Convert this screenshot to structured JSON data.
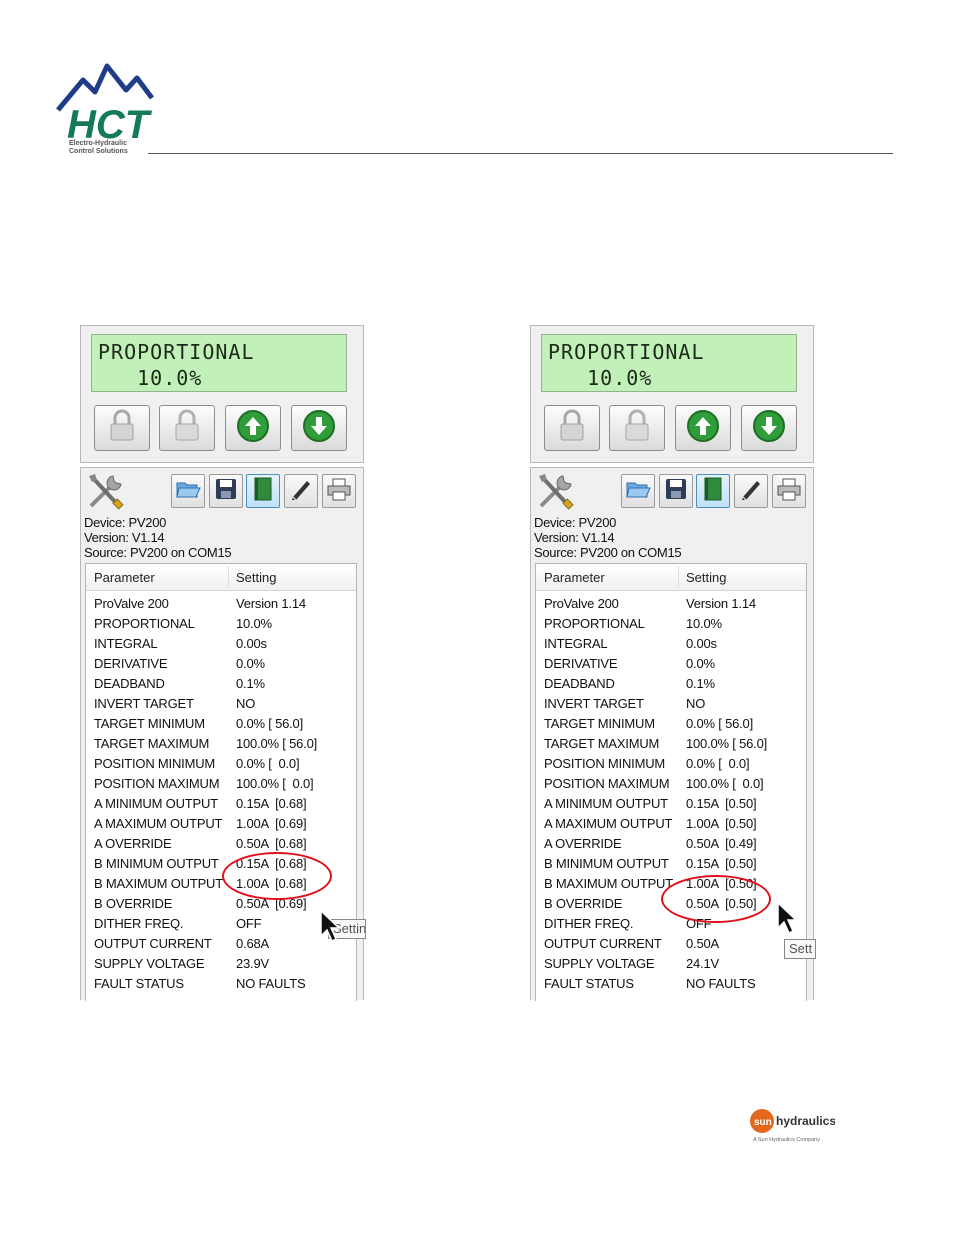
{
  "brand": {
    "name": "HCT",
    "tagline_line1": "Electro-Hydraulic",
    "tagline_line2": "Control Solutions",
    "colors": {
      "green": "#157a56",
      "blue": "#1f3c88"
    }
  },
  "footer_brand": {
    "name": "hydraulics",
    "prefix": "sun",
    "tagline": "A Sun Hydraulics Company"
  },
  "panels": [
    {
      "lcd": {
        "line1": "PROPORTIONAL",
        "line2": "   10.0%"
      },
      "buttons": [
        "lock-icon",
        "unlock-icon",
        "arrow-up-icon",
        "arrow-down-icon"
      ],
      "toolbar": [
        "tools-icon",
        "open-folder-icon",
        "save-icon",
        "book-icon",
        "pencil-icon",
        "print-icon"
      ],
      "info": {
        "device": "Device: PV200",
        "version": "Version: V1.14",
        "source": "Source: PV200 on COM15"
      },
      "columns": {
        "parameter": "Parameter",
        "setting": "Setting"
      },
      "rows": [
        {
          "parameter": "ProValve 200",
          "setting": "Version 1.14"
        },
        {
          "parameter": "PROPORTIONAL",
          "setting": "10.0%"
        },
        {
          "parameter": "INTEGRAL",
          "setting": "0.00s"
        },
        {
          "parameter": "DERIVATIVE",
          "setting": "0.0%"
        },
        {
          "parameter": "DEADBAND",
          "setting": "0.1%"
        },
        {
          "parameter": "INVERT TARGET",
          "setting": "NO"
        },
        {
          "parameter": "TARGET MINIMUM",
          "setting": "0.0% [ 56.0]"
        },
        {
          "parameter": "TARGET MAXIMUM",
          "setting": "100.0% [ 56.0]"
        },
        {
          "parameter": "POSITION MINIMUM",
          "setting": "0.0% [  0.0]"
        },
        {
          "parameter": "POSITION MAXIMUM",
          "setting": "100.0% [  0.0]"
        },
        {
          "parameter": "A MINIMUM OUTPUT",
          "setting": "0.15A  [0.68]"
        },
        {
          "parameter": "A MAXIMUM OUTPUT",
          "setting": "1.00A  [0.69]"
        },
        {
          "parameter": "A OVERRIDE",
          "setting": "0.50A  [0.68]"
        },
        {
          "parameter": "B MINIMUM OUTPUT",
          "setting": "0.15A  [0.68]"
        },
        {
          "parameter": "B MAXIMUM OUTPUT",
          "setting": "1.00A  [0.68]"
        },
        {
          "parameter": "B OVERRIDE",
          "setting": "0.50A  [0.69]"
        },
        {
          "parameter": "DITHER FREQ.",
          "setting": "OFF"
        },
        {
          "parameter": "OUTPUT CURRENT",
          "setting": "0.68A"
        },
        {
          "parameter": "SUPPLY VOLTAGE",
          "setting": "23.9V"
        },
        {
          "parameter": "FAULT STATUS",
          "setting": "NO FAULTS"
        }
      ],
      "tooltip": "Settin"
    },
    {
      "lcd": {
        "line1": "PROPORTIONAL",
        "line2": "   10.0%"
      },
      "buttons": [
        "lock-icon",
        "unlock-icon",
        "arrow-up-icon",
        "arrow-down-icon"
      ],
      "toolbar": [
        "tools-icon",
        "open-folder-icon",
        "save-icon",
        "book-icon",
        "pencil-icon",
        "print-icon"
      ],
      "info": {
        "device": "Device: PV200",
        "version": "Version: V1.14",
        "source": "Source: PV200 on COM15"
      },
      "columns": {
        "parameter": "Parameter",
        "setting": "Setting"
      },
      "rows": [
        {
          "parameter": "ProValve 200",
          "setting": "Version 1.14"
        },
        {
          "parameter": "PROPORTIONAL",
          "setting": "10.0%"
        },
        {
          "parameter": "INTEGRAL",
          "setting": "0.00s"
        },
        {
          "parameter": "DERIVATIVE",
          "setting": "0.0%"
        },
        {
          "parameter": "DEADBAND",
          "setting": "0.1%"
        },
        {
          "parameter": "INVERT TARGET",
          "setting": "NO"
        },
        {
          "parameter": "TARGET MINIMUM",
          "setting": "0.0% [ 56.0]"
        },
        {
          "parameter": "TARGET MAXIMUM",
          "setting": "100.0% [ 56.0]"
        },
        {
          "parameter": "POSITION MINIMUM",
          "setting": "0.0% [  0.0]"
        },
        {
          "parameter": "POSITION MAXIMUM",
          "setting": "100.0% [  0.0]"
        },
        {
          "parameter": "A MINIMUM OUTPUT",
          "setting": "0.15A  [0.50]"
        },
        {
          "parameter": "A MAXIMUM OUTPUT",
          "setting": "1.00A  [0.50]"
        },
        {
          "parameter": "A OVERRIDE",
          "setting": "0.50A  [0.49]"
        },
        {
          "parameter": "B MINIMUM OUTPUT",
          "setting": "0.15A  [0.50]"
        },
        {
          "parameter": "B MAXIMUM OUTPUT",
          "setting": "1.00A  [0.50]"
        },
        {
          "parameter": "B OVERRIDE",
          "setting": "0.50A  [0.50]"
        },
        {
          "parameter": "DITHER FREQ.",
          "setting": "OFF"
        },
        {
          "parameter": "OUTPUT CURRENT",
          "setting": "0.50A"
        },
        {
          "parameter": "SUPPLY VOLTAGE",
          "setting": "24.1V"
        },
        {
          "parameter": "FAULT STATUS",
          "setting": "NO FAULTS"
        }
      ],
      "tooltip": "Sett"
    }
  ]
}
